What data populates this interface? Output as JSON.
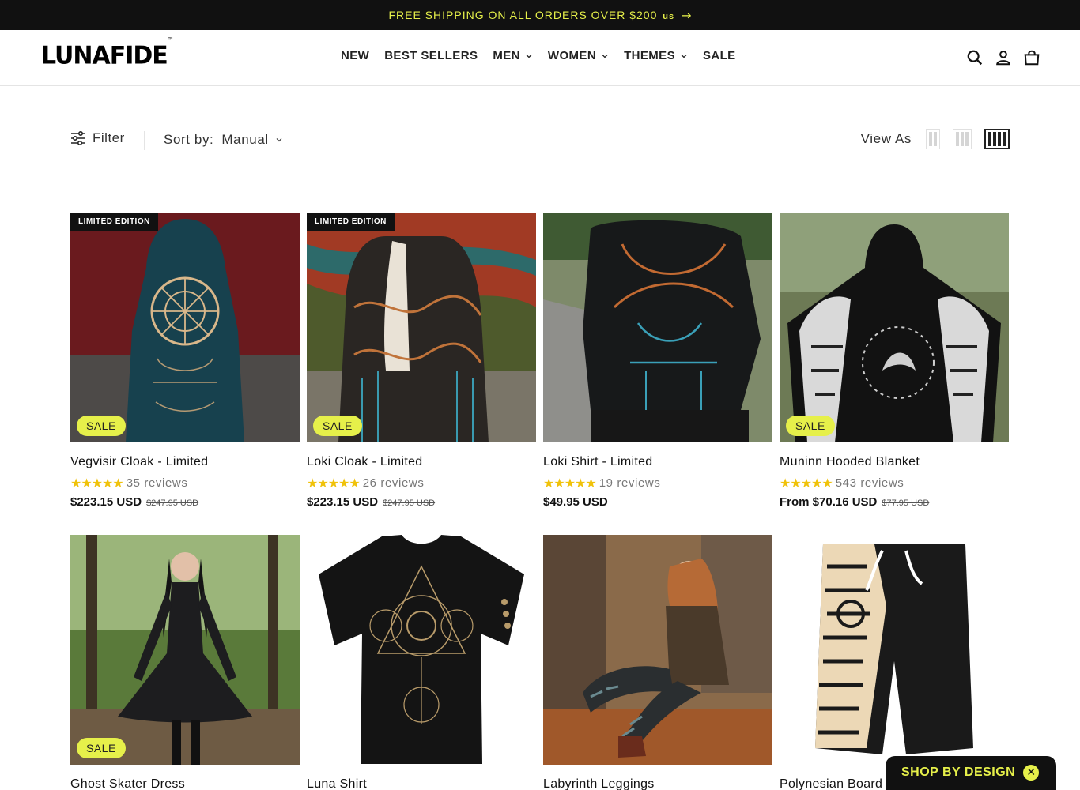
{
  "announcement": {
    "text": "FREE SHIPPING ON ALL ORDERS OVER $200",
    "currency": "us"
  },
  "brand": {
    "logo": "LUNAFIDE",
    "tm": "™"
  },
  "nav": [
    {
      "label": "NEW",
      "dropdown": false
    },
    {
      "label": "BEST SELLERS",
      "dropdown": false
    },
    {
      "label": "MEN",
      "dropdown": true
    },
    {
      "label": "WOMEN",
      "dropdown": true
    },
    {
      "label": "THEMES",
      "dropdown": true
    },
    {
      "label": "SALE",
      "dropdown": false
    }
  ],
  "toolbar": {
    "filter_label": "Filter",
    "sort_label": "Sort by:",
    "sort_value": "Manual",
    "view_as_label": "View As",
    "view_options": [
      2,
      3,
      4
    ],
    "active_view": 4
  },
  "products": [
    {
      "title": "Vegvisir Cloak - Limited",
      "stars": "★★★★★",
      "reviews": "35 reviews",
      "price": "$223.15 USD",
      "compare_price": "$247.95 USD",
      "limited_badge": "LIMITED EDITION",
      "sale_badge": "SALE"
    },
    {
      "title": "Loki Cloak - Limited",
      "stars": "★★★★★",
      "reviews": "26 reviews",
      "price": "$223.15 USD",
      "compare_price": "$247.95 USD",
      "limited_badge": "LIMITED EDITION",
      "sale_badge": "SALE"
    },
    {
      "title": "Loki Shirt - Limited",
      "stars": "★★★★★",
      "reviews": "19 reviews",
      "price": "$49.95 USD",
      "compare_price": "",
      "limited_badge": "",
      "sale_badge": ""
    },
    {
      "title": "Muninn Hooded Blanket",
      "stars": "★★★★★",
      "reviews": "543 reviews",
      "price": "From $70.16 USD",
      "compare_price": "$77.95 USD",
      "limited_badge": "",
      "sale_badge": "SALE"
    },
    {
      "title": "Ghost Skater Dress",
      "sale_badge": "SALE"
    },
    {
      "title": "Luna Shirt",
      "sale_badge": ""
    },
    {
      "title": "Labyrinth Leggings",
      "sale_badge": ""
    },
    {
      "title": "Polynesian Board",
      "sale_badge": ""
    }
  ],
  "floating_button": {
    "label": "SHOP BY DESIGN",
    "close": "✕"
  },
  "colors": {
    "accent": "#e6f04a",
    "dark": "#111111",
    "star": "#f0c20a"
  }
}
